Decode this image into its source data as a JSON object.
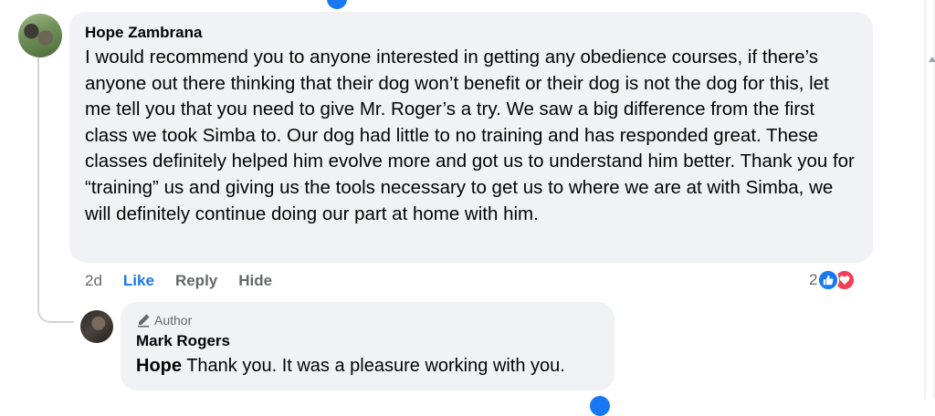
{
  "comment": {
    "author": "Hope Zambrana",
    "text": "I would recommend you to anyone interested in getting any obedience courses, if there’s anyone out there thinking that their dog won’t benefit or their dog is not the dog for this, let me tell you that you need to give Mr. Roger’s a try. We saw a big difference from the first class we took Simba to. Our dog had little to no training and has responded great. These classes definitely helped him evolve more and got us to understand him better. Thank you for “training” us and giving us the tools necessary to get us to where we are at with Simba, we will definitely continue doing our part at home with him.",
    "time": "2d",
    "like_label": "Like",
    "reply_label": "Reply",
    "hide_label": "Hide",
    "reaction_count": "2",
    "reaction_icons": [
      "like-icon",
      "love-icon"
    ]
  },
  "reply": {
    "badge": "Author",
    "author": "Mark Rogers",
    "mention": "Hope",
    "text": " Thank you. It was a pleasure working with you."
  },
  "colors": {
    "bubble_bg": "#f0f2f5",
    "like_blue": "#1877f2",
    "love_red": "#f33e58",
    "muted_text": "#65676b"
  }
}
